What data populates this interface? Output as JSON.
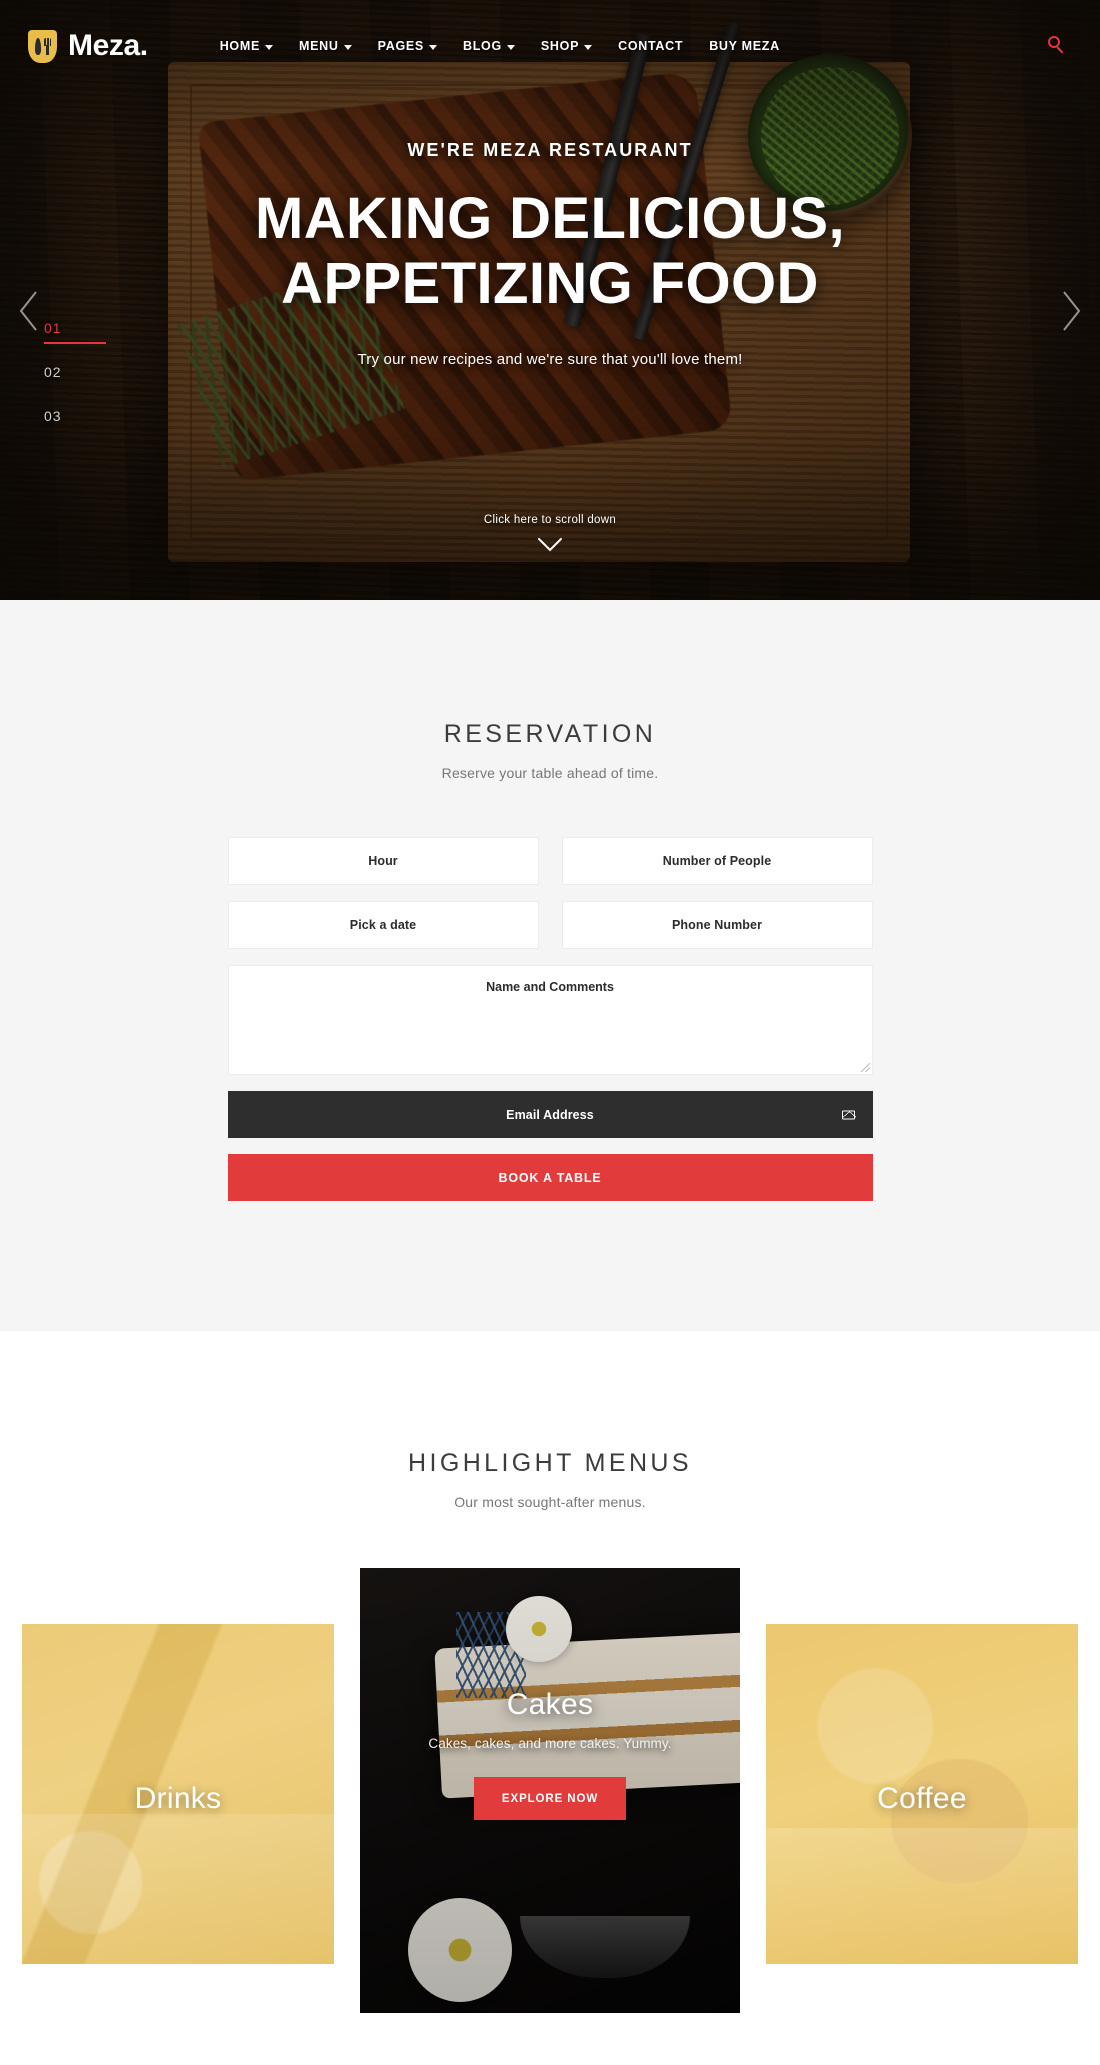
{
  "header": {
    "brand_name": "Meza.",
    "nav_items": [
      {
        "label": "HOME",
        "has_caret": true
      },
      {
        "label": "MENU",
        "has_caret": true
      },
      {
        "label": "PAGES",
        "has_caret": true
      },
      {
        "label": "BLOG",
        "has_caret": true
      },
      {
        "label": "SHOP",
        "has_caret": true
      },
      {
        "label": "CONTACT",
        "has_caret": false
      },
      {
        "label": "BUY MEZA",
        "has_caret": false
      }
    ]
  },
  "hero": {
    "eyebrow": "WE'RE MEZA RESTAURANT",
    "title_line1": "MAKING DELICIOUS,",
    "title_line2": "APPETIZING FOOD",
    "subtitle": "Try our new recipes and we're sure that you'll love them!",
    "scroll_label": "Click here to scroll down",
    "slides": [
      {
        "number": "01",
        "active": true
      },
      {
        "number": "02",
        "active": false
      },
      {
        "number": "03",
        "active": false
      }
    ]
  },
  "reservation": {
    "title": "RESERVATION",
    "subtitle": "Reserve your table ahead of time.",
    "fields": {
      "hour": "Hour",
      "people": "Number of People",
      "date": "Pick a date",
      "phone": "Phone Number",
      "comments": "Name and Comments",
      "email": "Email Address"
    },
    "submit_label": "BOOK A TABLE"
  },
  "highlights": {
    "title": "HIGHLIGHT MENUS",
    "subtitle": "Our most sought-after menus.",
    "cards": [
      {
        "title": "Drinks",
        "desc": "",
        "cta": ""
      },
      {
        "title": "Cakes",
        "desc": "Cakes, cakes, and more cakes. Yummy.",
        "cta": "EXPLORE NOW"
      },
      {
        "title": "Coffee",
        "desc": "",
        "cta": ""
      }
    ]
  },
  "colors": {
    "accent_red": "#e23b3b",
    "brand_gold": "#e8bd4a",
    "dark_bar": "#2e2e2e",
    "section_bg": "#f5f5f5"
  }
}
